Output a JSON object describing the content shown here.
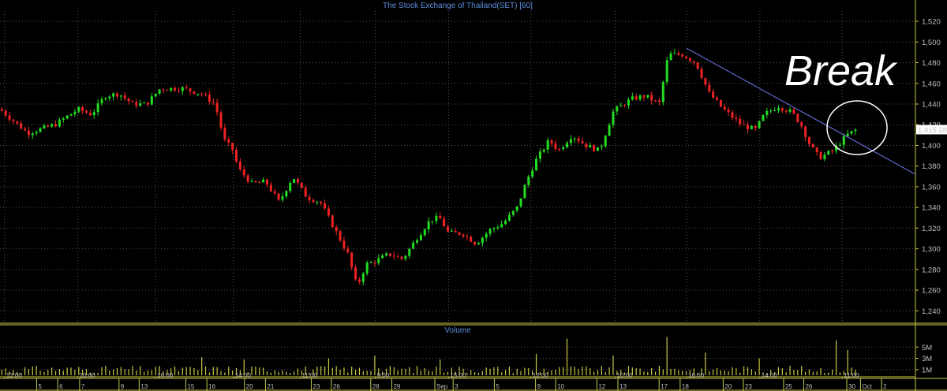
{
  "chart_data": {
    "type": "candlestick",
    "title": "The Stock Exchange of Thailand(SET) [60]",
    "y_axis": {
      "ticks": [
        "1,240",
        "1,260",
        "1,280",
        "1,300",
        "1,320",
        "1,340",
        "1,360",
        "1,380",
        "1,400",
        "1,420",
        "1,440",
        "1,460",
        "1,480",
        "1,500",
        "1,520"
      ],
      "tick_values": [
        1240,
        1260,
        1280,
        1300,
        1320,
        1340,
        1360,
        1380,
        1400,
        1420,
        1440,
        1460,
        1480,
        1500,
        1520
      ],
      "ylim": [
        1228,
        1530
      ]
    },
    "last_price_label": "1,415.28",
    "last_price": 1415.28,
    "annotation": "Break",
    "trendline": {
      "start": [
        0,
        1494
      ],
      "end": [
        1,
        1372
      ]
    },
    "close_path_anchors": [
      [
        0.0,
        1435
      ],
      [
        0.03,
        1412
      ],
      [
        0.06,
        1420
      ],
      [
        0.085,
        1435
      ],
      [
        0.1,
        1430
      ],
      [
        0.115,
        1448
      ],
      [
        0.13,
        1450
      ],
      [
        0.145,
        1440
      ],
      [
        0.16,
        1440
      ],
      [
        0.175,
        1455
      ],
      [
        0.2,
        1455
      ],
      [
        0.22,
        1450
      ],
      [
        0.235,
        1440
      ],
      [
        0.245,
        1405
      ],
      [
        0.255,
        1395
      ],
      [
        0.26,
        1378
      ],
      [
        0.275,
        1363
      ],
      [
        0.29,
        1365
      ],
      [
        0.305,
        1345
      ],
      [
        0.32,
        1370
      ],
      [
        0.335,
        1350
      ],
      [
        0.35,
        1345
      ],
      [
        0.365,
        1320
      ],
      [
        0.38,
        1295
      ],
      [
        0.39,
        1263
      ],
      [
        0.4,
        1285
      ],
      [
        0.41,
        1288
      ],
      [
        0.425,
        1295
      ],
      [
        0.44,
        1290
      ],
      [
        0.455,
        1310
      ],
      [
        0.47,
        1328
      ],
      [
        0.48,
        1330
      ],
      [
        0.49,
        1315
      ],
      [
        0.505,
        1315
      ],
      [
        0.52,
        1305
      ],
      [
        0.535,
        1318
      ],
      [
        0.55,
        1325
      ],
      [
        0.565,
        1340
      ],
      [
        0.575,
        1365
      ],
      [
        0.585,
        1385
      ],
      [
        0.6,
        1405
      ],
      [
        0.61,
        1395
      ],
      [
        0.625,
        1410
      ],
      [
        0.64,
        1400
      ],
      [
        0.655,
        1395
      ],
      [
        0.67,
        1433
      ],
      [
        0.69,
        1445
      ],
      [
        0.705,
        1448
      ],
      [
        0.72,
        1440
      ],
      [
        0.73,
        1488
      ],
      [
        0.745,
        1488
      ],
      [
        0.76,
        1480
      ],
      [
        0.775,
        1450
      ],
      [
        0.79,
        1435
      ],
      [
        0.81,
        1420
      ],
      [
        0.825,
        1415
      ],
      [
        0.835,
        1430
      ],
      [
        0.85,
        1438
      ],
      [
        0.865,
        1432
      ],
      [
        0.875,
        1420
      ],
      [
        0.885,
        1400
      ],
      [
        0.895,
        1388
      ],
      [
        0.91,
        1395
      ],
      [
        0.925,
        1410
      ],
      [
        0.935,
        1415
      ]
    ],
    "x_axis_top_labels": [
      {
        "pos": 0.005,
        "label": "12:00"
      },
      {
        "pos": 0.085,
        "label": "10:00"
      },
      {
        "pos": 0.17,
        "label": "16:00"
      },
      {
        "pos": 0.255,
        "label": "14:00"
      },
      {
        "pos": 0.328,
        "label": "11:00"
      },
      {
        "pos": 0.41,
        "label": "9:00"
      },
      {
        "pos": 0.49,
        "label": "15:00"
      },
      {
        "pos": 0.58,
        "label": "12:00"
      },
      {
        "pos": 0.672,
        "label": "10:00"
      },
      {
        "pos": 0.75,
        "label": "16:00"
      },
      {
        "pos": 0.83,
        "label": "14:00"
      },
      {
        "pos": 0.92,
        "label": "11:00"
      }
    ],
    "x_axis_bottom_labels": [
      {
        "pos": 0.04,
        "label": "5"
      },
      {
        "pos": 0.063,
        "label": "6"
      },
      {
        "pos": 0.087,
        "label": "7"
      },
      {
        "pos": 0.13,
        "label": "9"
      },
      {
        "pos": 0.152,
        "label": "13"
      },
      {
        "pos": 0.203,
        "label": "15"
      },
      {
        "pos": 0.226,
        "label": "16"
      },
      {
        "pos": 0.267,
        "label": "20"
      },
      {
        "pos": 0.29,
        "label": "21"
      },
      {
        "pos": 0.34,
        "label": "23"
      },
      {
        "pos": 0.362,
        "label": "26"
      },
      {
        "pos": 0.405,
        "label": "28"
      },
      {
        "pos": 0.428,
        "label": "29"
      },
      {
        "pos": 0.475,
        "label": "Sep"
      },
      {
        "pos": 0.495,
        "label": "3"
      },
      {
        "pos": 0.54,
        "label": "5"
      },
      {
        "pos": 0.585,
        "label": "9"
      },
      {
        "pos": 0.607,
        "label": "10"
      },
      {
        "pos": 0.652,
        "label": "12"
      },
      {
        "pos": 0.675,
        "label": "13"
      },
      {
        "pos": 0.72,
        "label": "17"
      },
      {
        "pos": 0.743,
        "label": "18"
      },
      {
        "pos": 0.79,
        "label": "20"
      },
      {
        "pos": 0.812,
        "label": "23"
      },
      {
        "pos": 0.856,
        "label": "25"
      },
      {
        "pos": 0.878,
        "label": "26"
      },
      {
        "pos": 0.925,
        "label": "30"
      },
      {
        "pos": 0.94,
        "label": "Oct"
      },
      {
        "pos": 0.963,
        "label": "2"
      }
    ],
    "volume": {
      "title": "Volume",
      "ticks": [
        "5M",
        "3M",
        "1M"
      ],
      "tick_values": [
        5,
        3,
        1
      ],
      "ylim": [
        0,
        7
      ],
      "unit": "M",
      "spikes": [
        {
          "pos": 0.22,
          "value": 3.2
        },
        {
          "pos": 0.265,
          "value": 2.8
        },
        {
          "pos": 0.36,
          "value": 3.0
        },
        {
          "pos": 0.41,
          "value": 3.5
        },
        {
          "pos": 0.48,
          "value": 2.8
        },
        {
          "pos": 0.585,
          "value": 3.8
        },
        {
          "pos": 0.62,
          "value": 6.5
        },
        {
          "pos": 0.67,
          "value": 3.5
        },
        {
          "pos": 0.73,
          "value": 6.8
        },
        {
          "pos": 0.77,
          "value": 4.0
        },
        {
          "pos": 0.83,
          "value": 3.0
        },
        {
          "pos": 0.913,
          "value": 6.2
        },
        {
          "pos": 0.925,
          "value": 4.5
        },
        {
          "pos": 0.94,
          "value": 2.5
        }
      ]
    },
    "colors": {
      "up": "#22dd22",
      "down": "#ee2222",
      "grid": "#555555",
      "frame": "#c8c846",
      "title": "#5b8fdc",
      "trendline": "#6e78ee",
      "volume_bars": "#c8c846",
      "price_box_bg": "#ffffff",
      "price_box_text": "#000000"
    }
  }
}
